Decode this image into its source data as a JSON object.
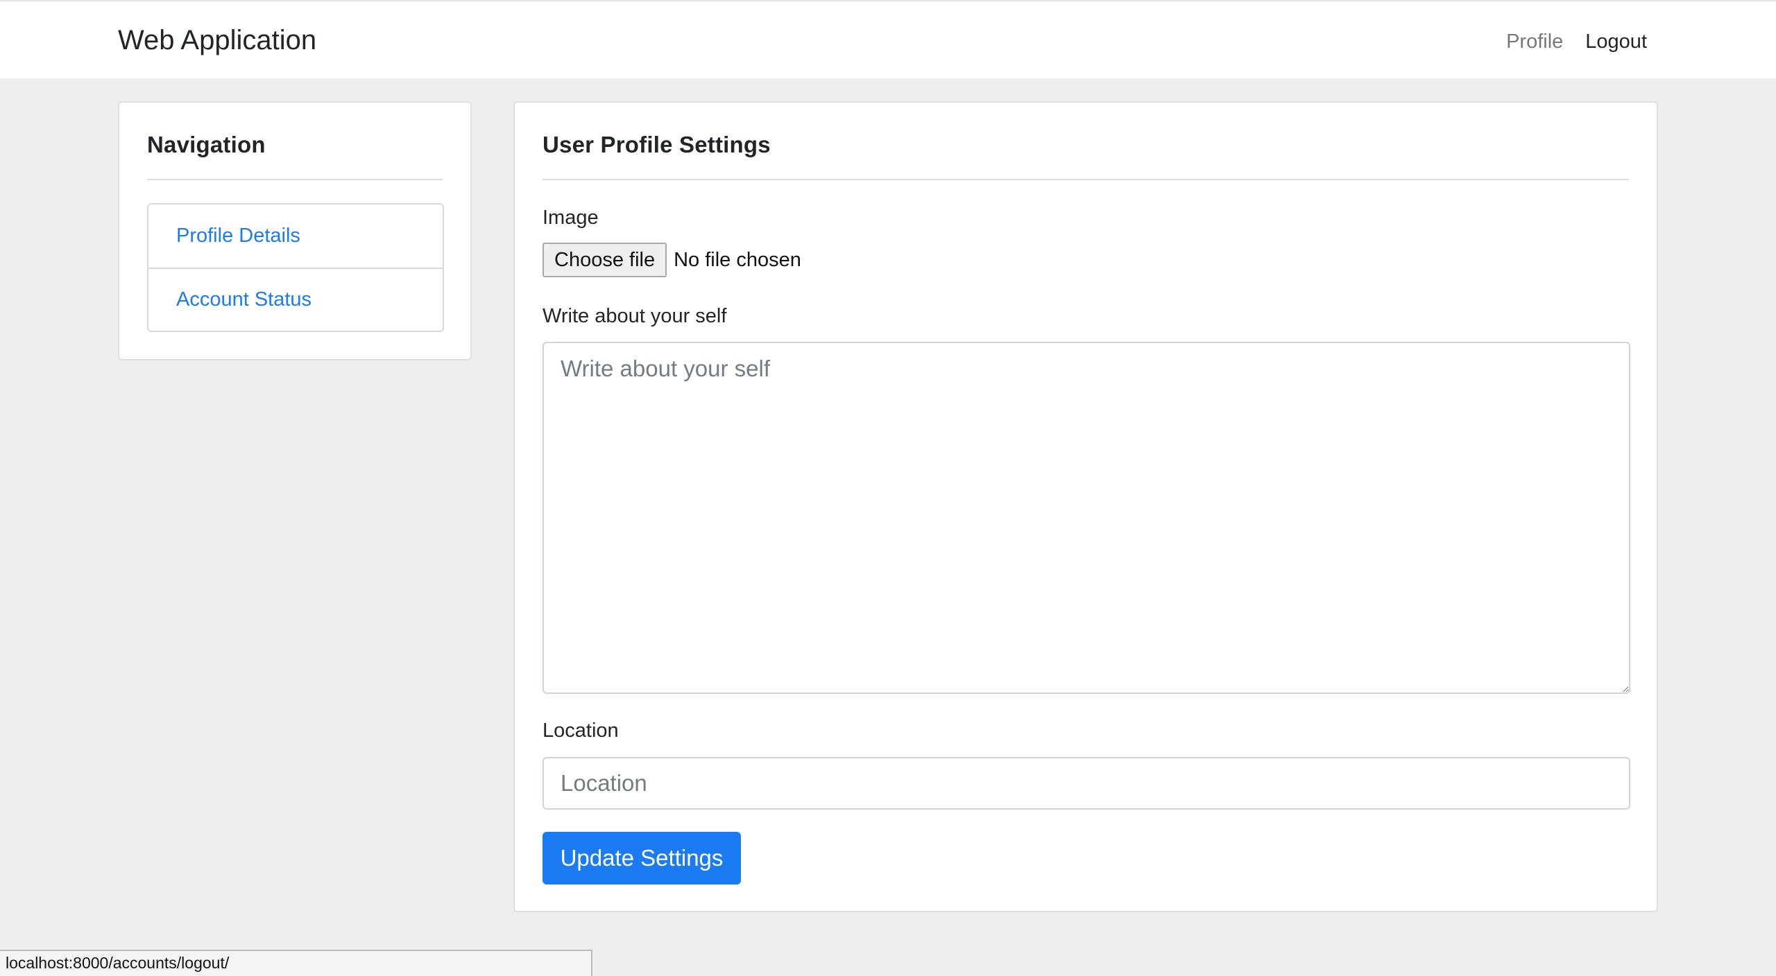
{
  "navbar": {
    "brand": "Web Application",
    "links": {
      "profile": "Profile",
      "logout": "Logout"
    }
  },
  "sidebar": {
    "title": "Navigation",
    "items": [
      {
        "label": "Profile Details"
      },
      {
        "label": "Account Status"
      }
    ]
  },
  "main": {
    "title": "User Profile Settings",
    "image": {
      "label": "Image",
      "button_label": "Choose file",
      "status": "No file chosen"
    },
    "about": {
      "label": "Write about your self",
      "placeholder": "Write about your self",
      "value": ""
    },
    "location": {
      "label": "Location",
      "placeholder": "Location",
      "value": ""
    },
    "submit_label": "Update Settings"
  },
  "status_bar": {
    "url": "localhost:8000/accounts/logout/"
  },
  "colors": {
    "accent": "#1a7bf2",
    "background": "#eeeeee",
    "card": "#ffffff"
  }
}
